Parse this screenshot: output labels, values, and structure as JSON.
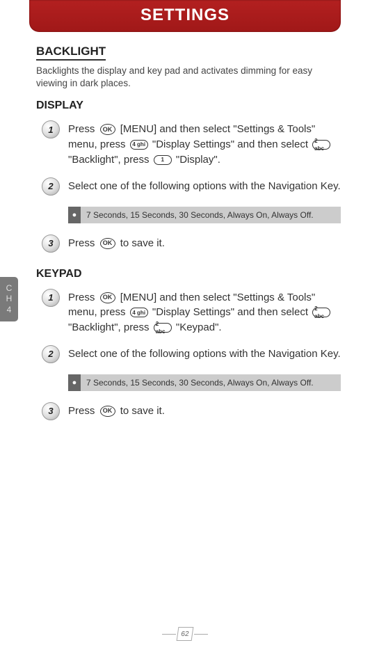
{
  "header": {
    "title": "SETTINGS"
  },
  "sideTab": {
    "line1": "C",
    "line2": "H",
    "line3": "4"
  },
  "section": {
    "title": "BACKLIGHT",
    "description": "Backlights the display and key pad and activates dimming for easy viewing in dark places."
  },
  "display": {
    "heading": "DISPLAY",
    "steps": {
      "s1": {
        "num": "1",
        "p1": "Press ",
        "p2": " [MENU] and then select \"Settings & Tools\" menu, press ",
        "p3": " \"Display Settings\" and then select ",
        "p4": " \"Backlight\", press ",
        "p5": " \"Display\"."
      },
      "s2": {
        "num": "2",
        "text": "Select one of the following options with the Navigation Key."
      },
      "s3": {
        "num": "3",
        "p1": "Press ",
        "p2": " to save it."
      }
    },
    "options": "7 Seconds, 15 Seconds, 30 Seconds, Always On, Always Off."
  },
  "keypad": {
    "heading": "KEYPAD",
    "steps": {
      "s1": {
        "num": "1",
        "p1": "Press ",
        "p2": " [MENU] and then select \"Settings & Tools\" menu, press ",
        "p3": " \"Display Settings\" and then select ",
        "p4": " \"Backlight\", press ",
        "p5": " \"Keypad\"."
      },
      "s2": {
        "num": "2",
        "text": "Select one of the following options with the Navigation Key."
      },
      "s3": {
        "num": "3",
        "p1": "Press ",
        "p2": " to save it."
      }
    },
    "options": "7 Seconds, 15 Seconds, 30 Seconds, Always On, Always Off."
  },
  "icons": {
    "ok": "OK",
    "key4": "4 ghi",
    "key2": "2 abc",
    "key1": "1"
  },
  "page": {
    "number": "62"
  }
}
